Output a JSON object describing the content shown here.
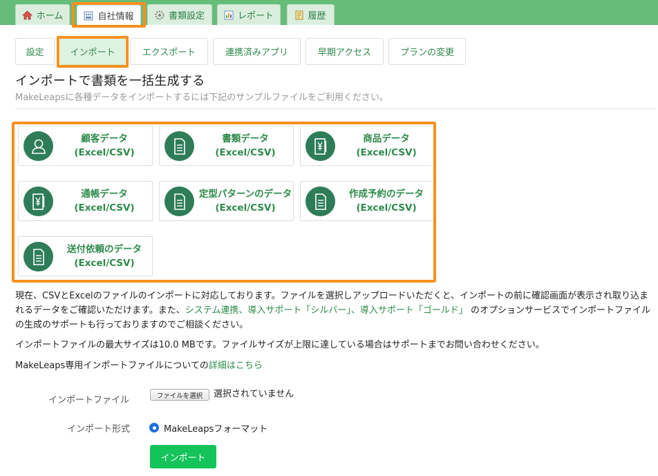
{
  "top_tabs": [
    {
      "label": "ホーム",
      "icon": "home-icon"
    },
    {
      "label": "自社情報",
      "icon": "company-icon"
    },
    {
      "label": "書類設定",
      "icon": "gear-icon"
    },
    {
      "label": "レポート",
      "icon": "report-icon"
    },
    {
      "label": "履歴",
      "icon": "history-icon"
    }
  ],
  "sub_tabs": [
    "設定",
    "インポート",
    "エクスポート",
    "連携済みアプリ",
    "早期アクセス",
    "プランの変更"
  ],
  "page": {
    "title": "インポートで書類を一括生成する",
    "subtitle": "MakeLeapsに各種データをインポートするには下記のサンプルファイルをご利用ください。"
  },
  "cards": [
    {
      "name": "顧客データ",
      "format": "(Excel/CSV)",
      "icon": "person-icon"
    },
    {
      "name": "書類データ",
      "format": "(Excel/CSV)",
      "icon": "document-icon"
    },
    {
      "name": "商品データ",
      "format": "(Excel/CSV)",
      "icon": "yen-book-icon"
    },
    {
      "name": "通帳データ",
      "format": "(Excel/CSV)",
      "icon": "yen-book-icon"
    },
    {
      "name": "定型パターンのデータ",
      "format": "(Excel/CSV)",
      "icon": "document-icon"
    },
    {
      "name": "作成予約のデータ",
      "format": "(Excel/CSV)",
      "icon": "document-icon"
    },
    {
      "name": "送付依頼のデータ",
      "format": "(Excel/CSV)",
      "icon": "document-icon"
    }
  ],
  "info": {
    "p1_before": "現在、CSVとExcelのファイルのインポートに対応しております。ファイルを選択しアップロードいただくと、インポートの前に確認画面が表示され取り込まれるデータをご確認いただけます。また、",
    "p1_link": "システム連携、導入サポート「シルバー」、導入サポート「ゴールド」",
    "p1_after": " のオプションサービスでインポートファイルの生成のサポートも行っておりますのでご相談ください。",
    "p2": "インポートファイルの最大サイズは10.0 MBです。ファイルサイズが上限に達している場合はサポートまでお問い合わせください。",
    "p3_before": "MakeLeaps専用インポートファイルについての",
    "p3_link": "詳細はこちら"
  },
  "form": {
    "file_label": "インポートファイル",
    "file_button": "ファイルを選択",
    "file_status": "選択されていません",
    "format_label": "インポート形式",
    "format_option": "MakeLeapsフォーマット",
    "submit": "インポート"
  },
  "colors": {
    "brand_green": "#66bd7a",
    "link_green": "#2d8a4a",
    "icon_green": "#2e7d58",
    "highlight_orange": "#f7901e",
    "button_green": "#14c35a"
  }
}
